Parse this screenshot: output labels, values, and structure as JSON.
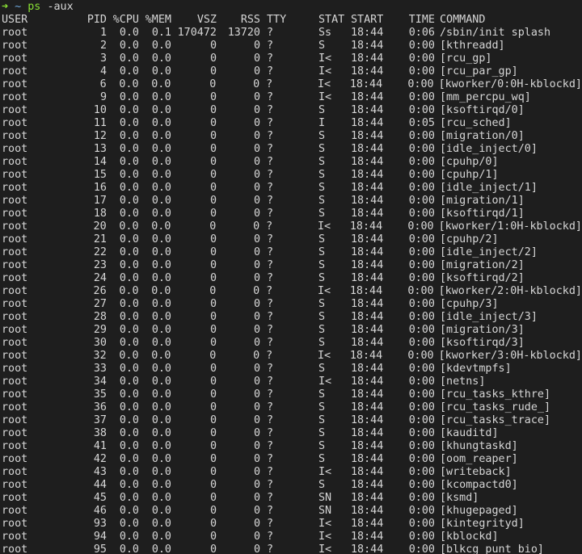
{
  "prompt": {
    "arrow": "➜",
    "dir": "~",
    "command": "ps",
    "args": "-aux"
  },
  "table": {
    "columns": [
      "USER",
      "PID",
      "%CPU",
      "%MEM",
      "VSZ",
      "RSS",
      "TTY",
      "STAT",
      "START",
      "TIME",
      "COMMAND"
    ],
    "rows": [
      [
        "root",
        "1",
        "0.0",
        "0.1",
        "170472",
        "13720",
        "?",
        "Ss",
        "18:44",
        "0:06",
        "/sbin/init splash"
      ],
      [
        "root",
        "2",
        "0.0",
        "0.0",
        "0",
        "0",
        "?",
        "S",
        "18:44",
        "0:00",
        "[kthreadd]"
      ],
      [
        "root",
        "3",
        "0.0",
        "0.0",
        "0",
        "0",
        "?",
        "I<",
        "18:44",
        "0:00",
        "[rcu_gp]"
      ],
      [
        "root",
        "4",
        "0.0",
        "0.0",
        "0",
        "0",
        "?",
        "I<",
        "18:44",
        "0:00",
        "[rcu_par_gp]"
      ],
      [
        "root",
        "6",
        "0.0",
        "0.0",
        "0",
        "0",
        "?",
        "I<",
        "18:44",
        "0:00",
        "[kworker/0:0H-kblockd]"
      ],
      [
        "root",
        "9",
        "0.0",
        "0.0",
        "0",
        "0",
        "?",
        "I<",
        "18:44",
        "0:00",
        "[mm_percpu_wq]"
      ],
      [
        "root",
        "10",
        "0.0",
        "0.0",
        "0",
        "0",
        "?",
        "S",
        "18:44",
        "0:00",
        "[ksoftirqd/0]"
      ],
      [
        "root",
        "11",
        "0.0",
        "0.0",
        "0",
        "0",
        "?",
        "I",
        "18:44",
        "0:05",
        "[rcu_sched]"
      ],
      [
        "root",
        "12",
        "0.0",
        "0.0",
        "0",
        "0",
        "?",
        "S",
        "18:44",
        "0:00",
        "[migration/0]"
      ],
      [
        "root",
        "13",
        "0.0",
        "0.0",
        "0",
        "0",
        "?",
        "S",
        "18:44",
        "0:00",
        "[idle_inject/0]"
      ],
      [
        "root",
        "14",
        "0.0",
        "0.0",
        "0",
        "0",
        "?",
        "S",
        "18:44",
        "0:00",
        "[cpuhp/0]"
      ],
      [
        "root",
        "15",
        "0.0",
        "0.0",
        "0",
        "0",
        "?",
        "S",
        "18:44",
        "0:00",
        "[cpuhp/1]"
      ],
      [
        "root",
        "16",
        "0.0",
        "0.0",
        "0",
        "0",
        "?",
        "S",
        "18:44",
        "0:00",
        "[idle_inject/1]"
      ],
      [
        "root",
        "17",
        "0.0",
        "0.0",
        "0",
        "0",
        "?",
        "S",
        "18:44",
        "0:00",
        "[migration/1]"
      ],
      [
        "root",
        "18",
        "0.0",
        "0.0",
        "0",
        "0",
        "?",
        "S",
        "18:44",
        "0:00",
        "[ksoftirqd/1]"
      ],
      [
        "root",
        "20",
        "0.0",
        "0.0",
        "0",
        "0",
        "?",
        "I<",
        "18:44",
        "0:00",
        "[kworker/1:0H-kblockd]"
      ],
      [
        "root",
        "21",
        "0.0",
        "0.0",
        "0",
        "0",
        "?",
        "S",
        "18:44",
        "0:00",
        "[cpuhp/2]"
      ],
      [
        "root",
        "22",
        "0.0",
        "0.0",
        "0",
        "0",
        "?",
        "S",
        "18:44",
        "0:00",
        "[idle_inject/2]"
      ],
      [
        "root",
        "23",
        "0.0",
        "0.0",
        "0",
        "0",
        "?",
        "S",
        "18:44",
        "0:00",
        "[migration/2]"
      ],
      [
        "root",
        "24",
        "0.0",
        "0.0",
        "0",
        "0",
        "?",
        "S",
        "18:44",
        "0:00",
        "[ksoftirqd/2]"
      ],
      [
        "root",
        "26",
        "0.0",
        "0.0",
        "0",
        "0",
        "?",
        "I<",
        "18:44",
        "0:00",
        "[kworker/2:0H-kblockd]"
      ],
      [
        "root",
        "27",
        "0.0",
        "0.0",
        "0",
        "0",
        "?",
        "S",
        "18:44",
        "0:00",
        "[cpuhp/3]"
      ],
      [
        "root",
        "28",
        "0.0",
        "0.0",
        "0",
        "0",
        "?",
        "S",
        "18:44",
        "0:00",
        "[idle_inject/3]"
      ],
      [
        "root",
        "29",
        "0.0",
        "0.0",
        "0",
        "0",
        "?",
        "S",
        "18:44",
        "0:00",
        "[migration/3]"
      ],
      [
        "root",
        "30",
        "0.0",
        "0.0",
        "0",
        "0",
        "?",
        "S",
        "18:44",
        "0:00",
        "[ksoftirqd/3]"
      ],
      [
        "root",
        "32",
        "0.0",
        "0.0",
        "0",
        "0",
        "?",
        "I<",
        "18:44",
        "0:00",
        "[kworker/3:0H-kblockd]"
      ],
      [
        "root",
        "33",
        "0.0",
        "0.0",
        "0",
        "0",
        "?",
        "S",
        "18:44",
        "0:00",
        "[kdevtmpfs]"
      ],
      [
        "root",
        "34",
        "0.0",
        "0.0",
        "0",
        "0",
        "?",
        "I<",
        "18:44",
        "0:00",
        "[netns]"
      ],
      [
        "root",
        "35",
        "0.0",
        "0.0",
        "0",
        "0",
        "?",
        "S",
        "18:44",
        "0:00",
        "[rcu_tasks_kthre]"
      ],
      [
        "root",
        "36",
        "0.0",
        "0.0",
        "0",
        "0",
        "?",
        "S",
        "18:44",
        "0:00",
        "[rcu_tasks_rude_]"
      ],
      [
        "root",
        "37",
        "0.0",
        "0.0",
        "0",
        "0",
        "?",
        "S",
        "18:44",
        "0:00",
        "[rcu_tasks_trace]"
      ],
      [
        "root",
        "38",
        "0.0",
        "0.0",
        "0",
        "0",
        "?",
        "S",
        "18:44",
        "0:00",
        "[kauditd]"
      ],
      [
        "root",
        "41",
        "0.0",
        "0.0",
        "0",
        "0",
        "?",
        "S",
        "18:44",
        "0:00",
        "[khungtaskd]"
      ],
      [
        "root",
        "42",
        "0.0",
        "0.0",
        "0",
        "0",
        "?",
        "S",
        "18:44",
        "0:00",
        "[oom_reaper]"
      ],
      [
        "root",
        "43",
        "0.0",
        "0.0",
        "0",
        "0",
        "?",
        "I<",
        "18:44",
        "0:00",
        "[writeback]"
      ],
      [
        "root",
        "44",
        "0.0",
        "0.0",
        "0",
        "0",
        "?",
        "S",
        "18:44",
        "0:00",
        "[kcompactd0]"
      ],
      [
        "root",
        "45",
        "0.0",
        "0.0",
        "0",
        "0",
        "?",
        "SN",
        "18:44",
        "0:00",
        "[ksmd]"
      ],
      [
        "root",
        "46",
        "0.0",
        "0.0",
        "0",
        "0",
        "?",
        "SN",
        "18:44",
        "0:00",
        "[khugepaged]"
      ],
      [
        "root",
        "93",
        "0.0",
        "0.0",
        "0",
        "0",
        "?",
        "I<",
        "18:44",
        "0:00",
        "[kintegrityd]"
      ],
      [
        "root",
        "94",
        "0.0",
        "0.0",
        "0",
        "0",
        "?",
        "I<",
        "18:44",
        "0:00",
        "[kblockd]"
      ],
      [
        "root",
        "95",
        "0.0",
        "0.0",
        "0",
        "0",
        "?",
        "I<",
        "18:44",
        "0:00",
        "[blkcg_punt_bio]"
      ]
    ]
  },
  "colors": {
    "background": "#1e1e1e",
    "text": "#d6d6d6",
    "prompt_green": "#8ae234",
    "prompt_blue": "#6fa8dc"
  }
}
